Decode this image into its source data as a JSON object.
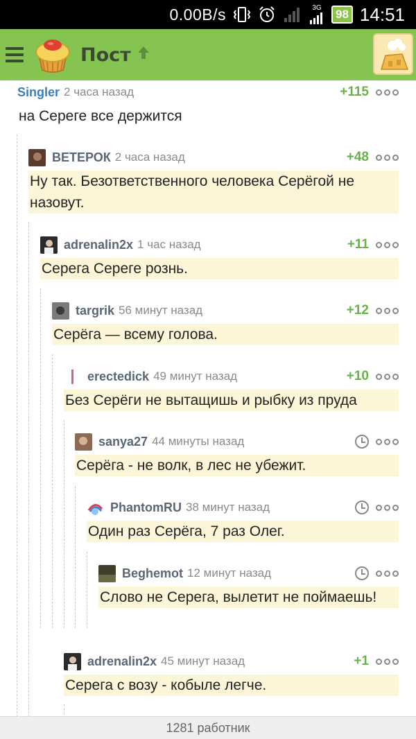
{
  "statusbar": {
    "speed": "0.00B/s",
    "battery": "98",
    "time": "14:51",
    "network": "3G"
  },
  "appbar": {
    "title": "Пост",
    "icons": {
      "menu": "menu-icon",
      "logo": "cupcake-logo-icon",
      "up": "arrow-up-icon",
      "avatar": "user-avatar-icon"
    }
  },
  "comments": [
    {
      "author": "Singler",
      "time": "2 часа назад",
      "rating": "+115",
      "text": "на Сереге все держится"
    },
    {
      "author": "ВЕТЕРОК",
      "time": "2 часа назад",
      "rating": "+48",
      "text": "Ну так. Безответственного человека Серёгой не назовут."
    },
    {
      "author": "adrenalin2x",
      "time": "1 час назад",
      "rating": "+11",
      "text": "Серега Сереге рознь."
    },
    {
      "author": "targrik",
      "time": "56 минут назад",
      "rating": "+12",
      "text": "Серёга — всему голова."
    },
    {
      "author": "erectedick",
      "time": "49 минут назад",
      "rating": "+10",
      "text": "Без Серёги не вытащишь и рыбку из пруда"
    },
    {
      "author": "sanya27",
      "time": "44 минуты назад",
      "rating": "",
      "text": "Серёга - не волк, в лес не убежит."
    },
    {
      "author": "PhantomRU",
      "time": "38 минут назад",
      "rating": "",
      "text": "Один раз Серёга, 7 раз Олег."
    },
    {
      "author": "Beghemot",
      "time": "12 минут назад",
      "rating": "",
      "text": "Слово не Серега, вылетит не поймаешь!"
    },
    {
      "author": "adrenalin2x",
      "time": "45 минут назад",
      "rating": "+1",
      "text": "Серега с возу - кобыле легче."
    }
  ],
  "footer": {
    "label": "1281 работник"
  },
  "colors": {
    "appbar": "#86c451",
    "rating": "#6ab04c",
    "highlight": "#fdf5d8",
    "author_blue": "#3b7cc1"
  }
}
